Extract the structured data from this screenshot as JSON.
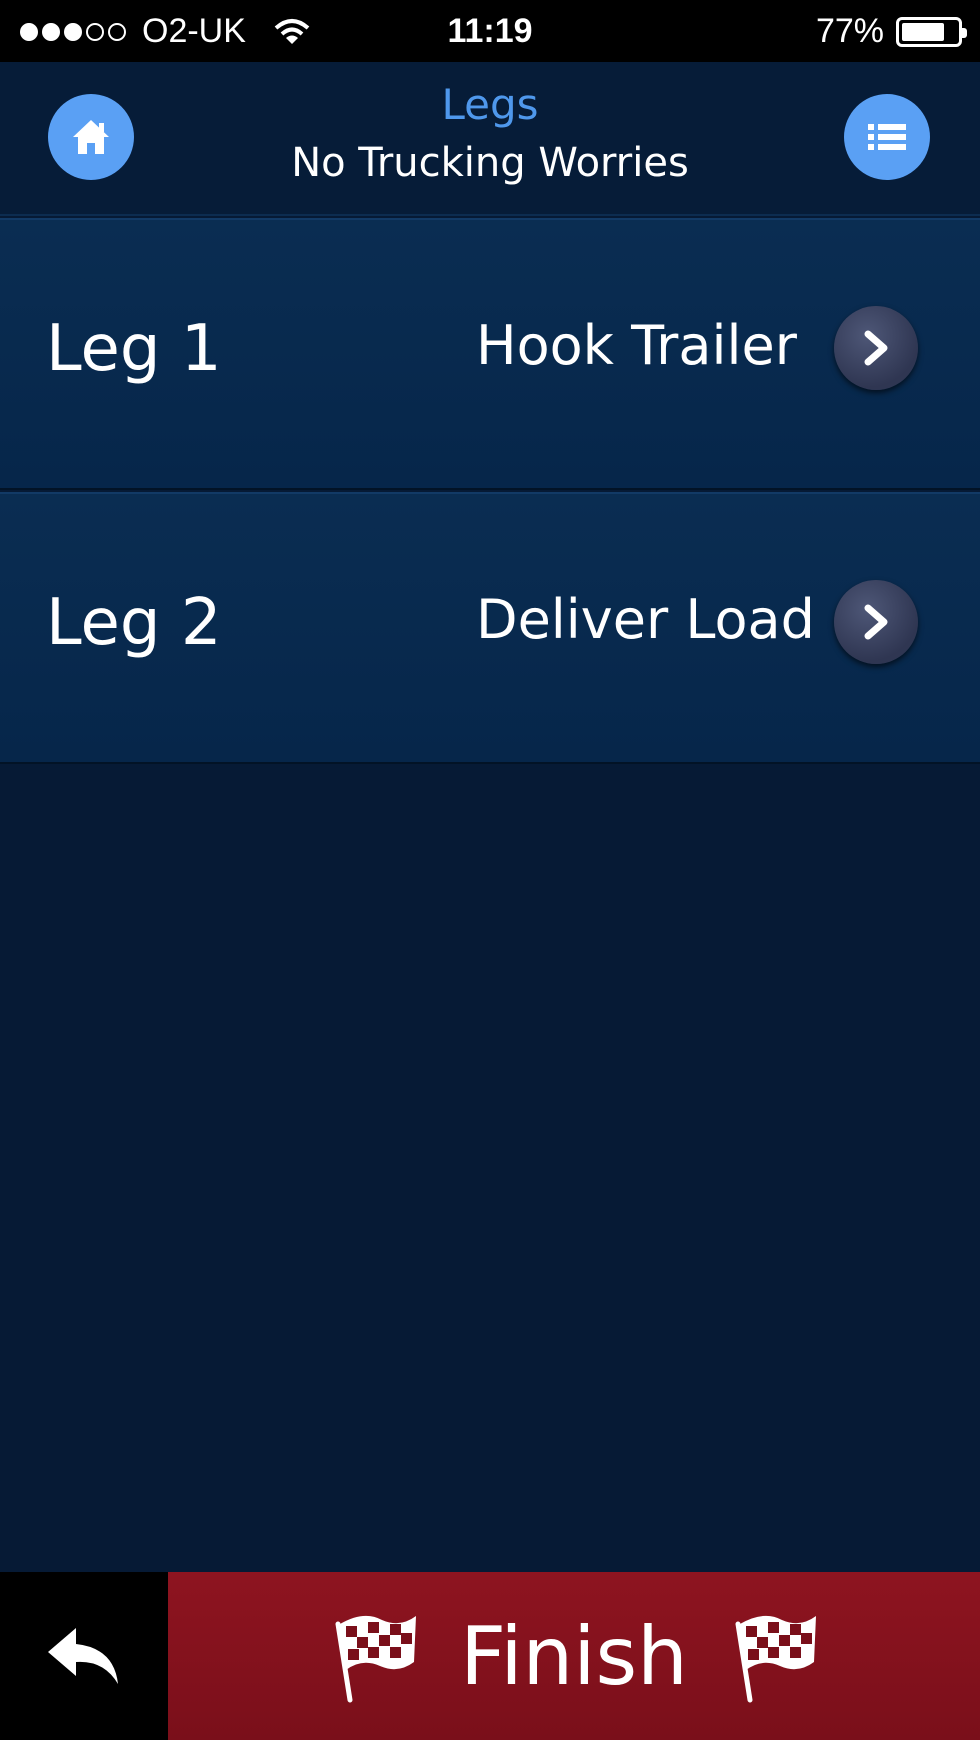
{
  "status_bar": {
    "carrier": "O2-UK",
    "signal_bars": [
      1,
      1,
      1,
      0,
      0
    ],
    "time": "11:19",
    "battery_percent_label": "77%",
    "battery_level": 0.77
  },
  "header": {
    "title": "Legs",
    "subtitle": "No Trucking Worries",
    "home_icon": "home-icon",
    "list_icon": "list-icon"
  },
  "legs": [
    {
      "name": "Leg 1",
      "action": "Hook Trailer"
    },
    {
      "name": "Leg 2",
      "action": "Deliver Load"
    }
  ],
  "bottom_bar": {
    "finish_label": "Finish",
    "back_icon": "back-arrow-icon",
    "flag_icon": "checkered-flag-icon"
  },
  "colors": {
    "accent_blue": "#5aa0f4",
    "finish_red": "#8e1420",
    "background": "#061a35"
  }
}
